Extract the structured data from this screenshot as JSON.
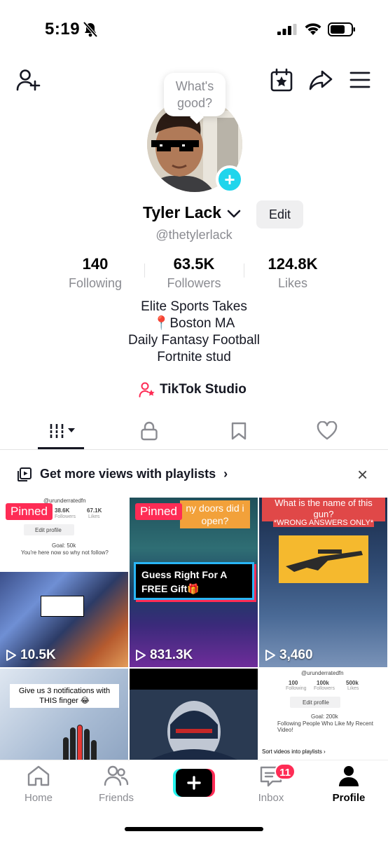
{
  "status_bar": {
    "time": "5:19"
  },
  "profile": {
    "bubble_text_line1": "What's",
    "bubble_text_line2": "good?",
    "display_name": "Tyler Lack",
    "edit_label": "Edit",
    "username": "@thetylerlack"
  },
  "stats": [
    {
      "value": "140",
      "label": "Following"
    },
    {
      "value": "63.5K",
      "label": "Followers"
    },
    {
      "value": "124.8K",
      "label": "Likes"
    }
  ],
  "bio": [
    "Elite Sports Takes",
    "📍Boston MA",
    "Daily Fantasy Football",
    "Fortnite stud"
  ],
  "studio_label": "TikTok Studio",
  "playlist_banner": {
    "text": "Get more views with playlists",
    "chevron": "›",
    "close": "×"
  },
  "grid": [
    {
      "pinned_label": "Pinned",
      "views": "10.5K",
      "mini": {
        "handle": "@urunderratedfn",
        "followers": "38.6K",
        "followers_label": "Followers",
        "likes": "67.1K",
        "likes_label": "Likes",
        "edit": "Edit profile",
        "goal": "Goal: 50k",
        "goal_sub": "You're here now so why not follow?"
      }
    },
    {
      "pinned_label": "Pinned",
      "views": "831.3K",
      "caption_top": "ny doors did i open?",
      "caption_box": "Guess Right For A FREE Gift🎁"
    },
    {
      "views": "3,460",
      "caption_top": "What is the name of this gun?",
      "caption_sub": "*WRONG ANSWERS ONLY*"
    },
    {
      "caption_top": "Give us 3 notifications with THIS finger 😂"
    },
    {},
    {
      "mini": {
        "handle": "@urunderratedfn",
        "following": "100",
        "following_label": "Following",
        "followers": "100k",
        "followers_label": "Followers",
        "likes": "500k",
        "likes_label": "Likes",
        "edit": "Edit profile",
        "goal": "Goal: 200k",
        "goal_sub": "Following People Who Like My Recent Video!",
        "sort": "Sort videos into playlists ›"
      }
    }
  ],
  "bottom_nav": [
    {
      "label": "Home"
    },
    {
      "label": "Friends"
    },
    {
      "label": "Inbox",
      "badge": "11"
    },
    {
      "label": "Profile"
    }
  ],
  "colors": {
    "accent": "#fe2c55",
    "cyan": "#20d5ec",
    "text": "#161823",
    "muted": "#8a8b91"
  },
  "icons": [
    "add-friend-icon",
    "calendar-star-icon",
    "share-icon",
    "menu-icon",
    "plus-icon",
    "studio-icon",
    "grid-icon",
    "lock-icon",
    "bookmark-icon",
    "heart-icon",
    "playlist-icon",
    "close-icon",
    "play-icon",
    "home-icon",
    "friends-icon",
    "create-icon",
    "inbox-icon",
    "profile-icon"
  ]
}
